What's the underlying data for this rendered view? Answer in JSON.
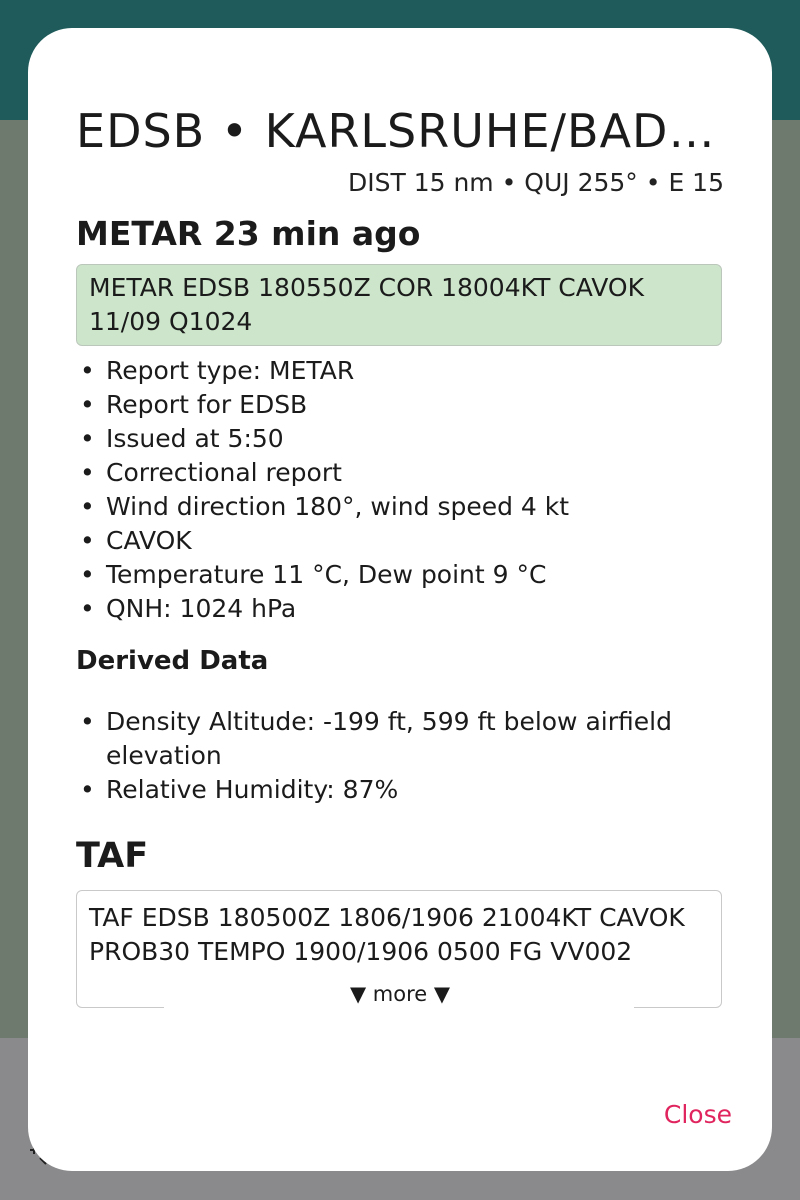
{
  "dialog": {
    "title": "EDSB • KARLSRUHE/BADEN-BADEN",
    "info": "DIST 15 nm • QUJ 255° • E 15",
    "close_label": "Close"
  },
  "metar": {
    "heading": "METAR 23 min ago",
    "raw": "METAR EDSB 180550Z COR 18004KT CAVOK 11/09 Q1024",
    "items": [
      "Report type: METAR",
      "Report for EDSB",
      "Issued at 5:50",
      "Correctional report",
      "Wind direction 180°, wind speed 4 kt",
      "CAVOK",
      "Temperature 11 °C, Dew point 9 °C",
      "QNH: 1024 hPa"
    ]
  },
  "derived": {
    "heading": "Derived Data",
    "items": [
      "Density Altitude: -199 ft, 599 ft below airfield elevation",
      "Relative Humidity: 87%"
    ]
  },
  "taf": {
    "heading": "TAF",
    "raw": "TAF EDSB 180500Z 1806/1906 21004KT CAVOK PROB30 TEMPO 1900/1906 0500 FG VV002",
    "more_label": "▼ more ▼"
  },
  "colors": {
    "appbar": "#1e5b5a",
    "metar_bg": "#cde6cb",
    "close": "#e0245e"
  }
}
